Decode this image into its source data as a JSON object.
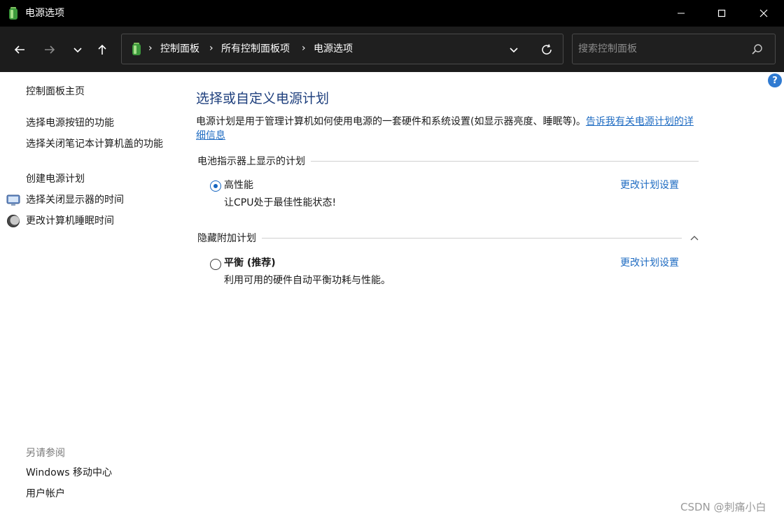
{
  "window": {
    "title": "电源选项",
    "minimize_icon": "minimize-icon",
    "maximize_icon": "maximize-icon",
    "close_icon": "close-icon"
  },
  "nav": {
    "back_icon": "arrow-left-icon",
    "forward_icon": "arrow-right-icon",
    "recent_icon": "chevron-down-icon",
    "up_icon": "arrow-up-icon",
    "breadcrumb": [
      "控制面板",
      "所有控制面板项",
      "电源选项"
    ],
    "search_placeholder": "搜索控制面板"
  },
  "sidebar": {
    "home_link": "控制面板主页",
    "links": [
      "选择电源按钮的功能",
      "选择关闭笔记本计算机盖的功能",
      "创建电源计划",
      "选择关闭显示器的时间",
      "更改计算机睡眠时间"
    ],
    "see_also_title": "另请参阅",
    "see_also": [
      "Windows 移动中心",
      "用户帐户"
    ]
  },
  "main": {
    "heading": "选择或自定义电源计划",
    "description": "电源计划是用于管理计算机如何使用电源的一套硬件和系统设置(如显示器亮度、睡眠等)。",
    "description_link": "告诉我有关电源计划的详细信息",
    "battery_section_title": "电池指示器上显示的计划",
    "hidden_section_title": "隐藏附加计划",
    "plans": [
      {
        "name": "高性能",
        "description": "让CPU处于最佳性能状态!",
        "link": "更改计划设置",
        "selected": true
      },
      {
        "name": "平衡 (推荐)",
        "description": "利用可用的硬件自动平衡功耗与性能。",
        "link": "更改计划设置",
        "selected": false
      }
    ]
  },
  "watermark": "CSDN @刺痛小白",
  "colors": {
    "titlebar": "#000000",
    "navbar": "#1c1c1c",
    "heading": "#1e3f7d",
    "link": "#1e6bc2",
    "radio_selected": "#1565c0"
  }
}
